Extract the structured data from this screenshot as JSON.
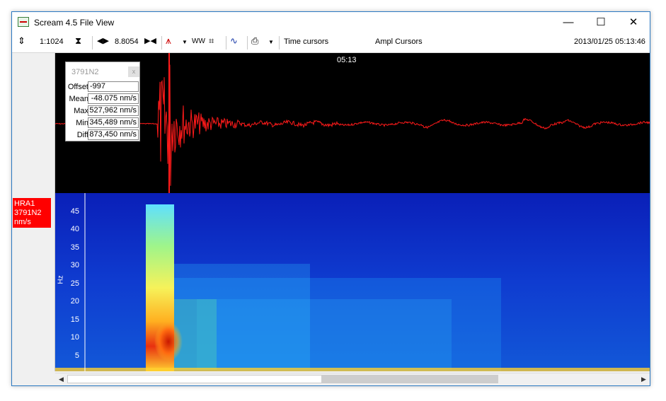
{
  "window": {
    "title": "Scream 4.5 File View"
  },
  "titlebar_buttons": {
    "minimize": "—",
    "maximize": "☐",
    "close": "✕"
  },
  "toolbar": {
    "zoom_value": "1:1024",
    "gain_value": "8.8054",
    "time_cursors": "Time cursors",
    "ampl_cursors": "Ampl Cursors",
    "timestamp": "2013/01/25 05:13:46"
  },
  "channel": {
    "line1": "HRA1",
    "line2": "3791N2",
    "line3": "nm/s"
  },
  "trace": {
    "time_label": "05:13",
    "trace_color": "#ff1a1a"
  },
  "info_box": {
    "title": "3791N2",
    "close": "x",
    "offset_label": "Offset",
    "offset": "-997",
    "mean_label": "Mean",
    "mean": "-48.075 nm/s",
    "max_label": "Max",
    "max": "527,962 nm/s",
    "min_label": "Min",
    "min": "345,489 nm/s",
    "diff_label": "Diff",
    "diff": "873,450 nm/s"
  },
  "spectrogram": {
    "ylabel": "Hz",
    "ticks": [
      "45",
      "40",
      "35",
      "30",
      "25",
      "20",
      "15",
      "10",
      "5"
    ]
  },
  "scrollbar": {
    "left": "◀",
    "right": "▶"
  }
}
